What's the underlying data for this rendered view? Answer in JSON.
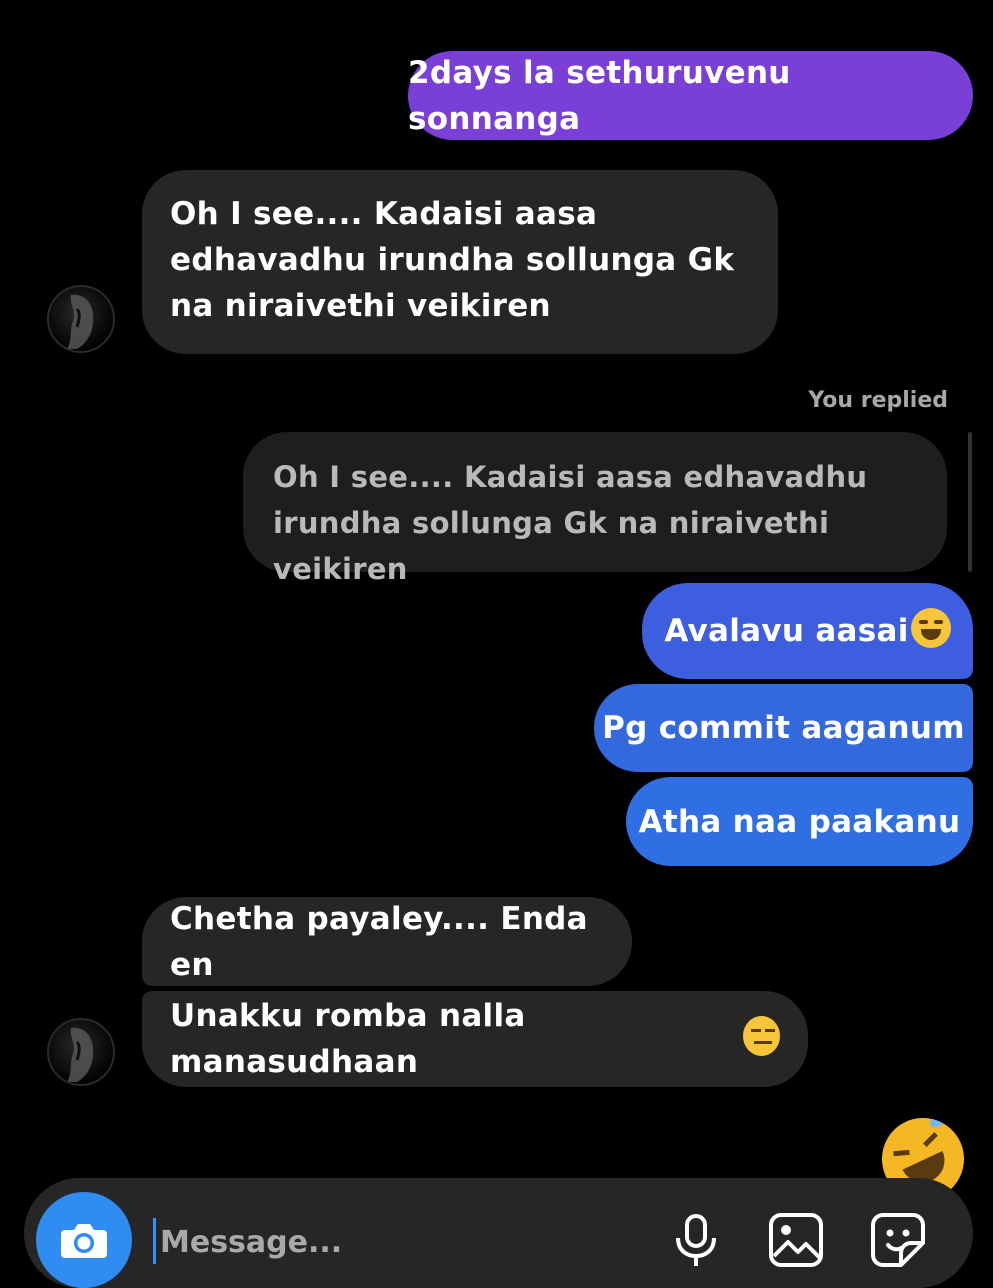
{
  "messages": {
    "sent_1": "2days la sethuruvenu sonnanga",
    "recv_1": "Oh I see.... Kadaisi aasa edhavadhu irundha sollunga Gk na niraivethi veikiren",
    "reply_label": "You replied",
    "reply_quote": "Oh I see.... Kadaisi aasa edhavadhu irundha sollunga Gk na niraivethi veikiren",
    "sent_2": "Avalavu aasai",
    "sent_3": "Pg commit aaganum",
    "sent_4": "Atha naa paakanu",
    "recv_2": "Chetha payaley.... Enda en",
    "recv_3": "Unakku romba nalla manasudhaan"
  },
  "composer": {
    "placeholder": "Message..."
  },
  "icons": {
    "camera": "camera-icon",
    "mic": "microphone-icon",
    "gallery": "gallery-icon",
    "sticker": "sticker-icon",
    "reaction": "rolling-on-floor-laughing-emoji"
  },
  "colors": {
    "sent_purple": "#7a3fd6",
    "sent_blue": "#3468dd",
    "received": "#262626",
    "camera_button": "#2f8cf0"
  }
}
